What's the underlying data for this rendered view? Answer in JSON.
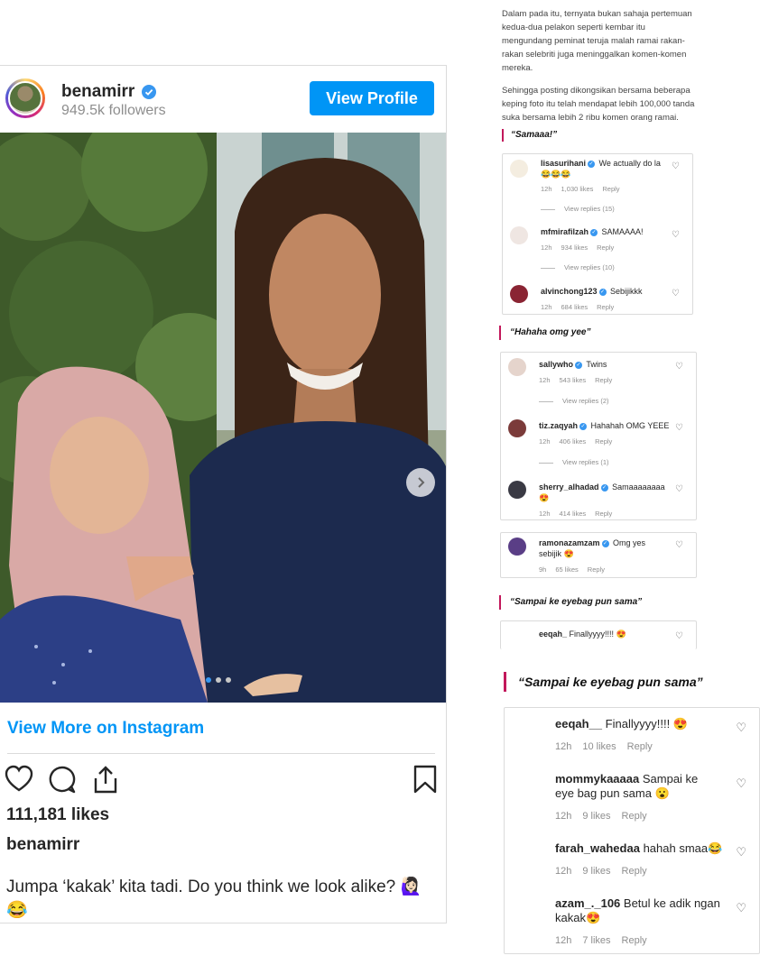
{
  "post": {
    "username": "benamirr",
    "followers": "949.5k followers",
    "view_profile_label": "View Profile",
    "view_more_label": "View More on Instagram",
    "likes": "111,181 likes",
    "caption_user": "benamirr",
    "caption": "Jumpa ‘kakak’ kita tadi. Do you think we look alike? 🙋🏻‍♀️ 😂",
    "carousel_total": 3,
    "carousel_active": 1
  },
  "article": {
    "paragraph1": "Dalam pada itu, ternyata bukan sahaja pertemuan kedua-dua pelakon seperti kembar itu mengundang peminat teruja malah ramai rakan-rakan selebriti juga meninggalkan komen-komen mereka.",
    "paragraph2": "Sehingga posting dikongsikan bersama beberapa keping foto itu telah mendapat lebih 100,000 tanda suka bersama lebih 2 ribu komen orang ramai."
  },
  "sections": {
    "s1_title": "“Samaaa!”",
    "s2_title": "“Hahaha omg yee”",
    "s3_title": "“Sampai ke eyebag pun sama”",
    "s4_title": "“Sampai ke eyebag pun sama”"
  },
  "box1": [
    {
      "user": "lisasurihani",
      "text": "We actually do la 😂😂😂",
      "time": "12h",
      "likes": "1,030 likes",
      "reply": "Reply",
      "replies": "View replies (15)"
    },
    {
      "user": "mfmirafilzah",
      "text": "SAMAAAA!",
      "time": "12h",
      "likes": "934 likes",
      "reply": "Reply",
      "replies": "View replies (10)"
    },
    {
      "user": "alvinchong123",
      "text": "Sebijikkk",
      "time": "12h",
      "likes": "684 likes",
      "reply": "Reply"
    }
  ],
  "box2": [
    {
      "user": "sallywho",
      "text": "Twins",
      "time": "12h",
      "likes": "543 likes",
      "reply": "Reply",
      "replies": "View replies (2)"
    },
    {
      "user": "tiz.zaqyah",
      "text": "Hahahah OMG YEEE",
      "time": "12h",
      "likes": "406 likes",
      "reply": "Reply",
      "replies": "View replies (1)"
    },
    {
      "user": "sherry_alhadad",
      "text": "Samaaaaaaaa 😍",
      "time": "12h",
      "likes": "414 likes",
      "reply": "Reply"
    }
  ],
  "box3": [
    {
      "user": "ramonazamzam",
      "text": "Omg yes sebijik 😍",
      "time": "9h",
      "likes": "65 likes",
      "reply": "Reply"
    }
  ],
  "box4": [
    {
      "user": "eeqah_",
      "text": "Finallyyyy!!!! 😍"
    }
  ],
  "box5": [
    {
      "user": "eeqah__",
      "text": "Finallyyyy!!!! 😍",
      "time": "12h",
      "likes": "10 likes",
      "reply": "Reply"
    },
    {
      "user": "mommykaaaaa",
      "text": "Sampai ke eye bag pun sama 😮",
      "time": "12h",
      "likes": "9 likes",
      "reply": "Reply"
    },
    {
      "user": "farah_wahedaa",
      "text": "hahah smaa😂",
      "time": "12h",
      "likes": "9 likes",
      "reply": "Reply"
    },
    {
      "user": "azam_._106",
      "text": "Betul ke adik ngan kakak😍",
      "time": "12h",
      "likes": "7 likes",
      "reply": "Reply"
    }
  ],
  "colors": {
    "accent": "#0095f6",
    "quote_bar": "#c2185b",
    "muted": "#8e8e8e"
  }
}
